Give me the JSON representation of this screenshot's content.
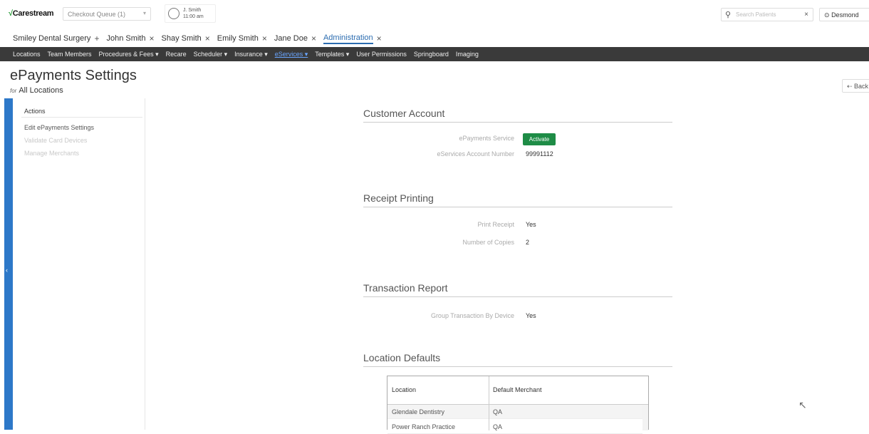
{
  "topbar": {
    "brand": "Carestream",
    "queue_label": "Checkout Queue (1)",
    "user_name": "J. Smith",
    "user_time": "11:00 am",
    "search_placeholder": "Search Patients",
    "account_name": "Desmond"
  },
  "tabs": [
    {
      "label": "Smiley Dental Surgery",
      "symbol": "+"
    },
    {
      "label": "John Smith",
      "symbol": "×"
    },
    {
      "label": "Shay Smith",
      "symbol": "×"
    },
    {
      "label": "Emily Smith",
      "symbol": "×"
    },
    {
      "label": "Jane Doe",
      "symbol": "×"
    },
    {
      "label": "Administration",
      "symbol": "×"
    }
  ],
  "nav": [
    "Locations",
    "Team Members",
    "Procedures & Fees ▾",
    "Recare",
    "Scheduler ▾",
    "Insurance ▾",
    "eServices ▾",
    "Templates ▾",
    "User Permissions",
    "Springboard",
    "Imaging"
  ],
  "page": {
    "title": "ePayments Settings",
    "for_label": "for",
    "scope": "All Locations",
    "back_label": "⇠ Back"
  },
  "sidebar": {
    "heading": "Actions",
    "links": [
      "Edit ePayments Settings",
      "Validate Card Devices",
      "Manage Merchants"
    ]
  },
  "customer_account": {
    "title": "Customer Account",
    "service_label": "ePayments Service",
    "activate_label": "Activate",
    "account_number_label": "eServices Account Number",
    "account_number": "99991112"
  },
  "receipt_printing": {
    "title": "Receipt Printing",
    "print_receipt_label": "Print Receipt",
    "print_receipt_value": "Yes",
    "copies_label": "Number of Copies",
    "copies_value": "2"
  },
  "transaction_report": {
    "title": "Transaction Report",
    "group_label": "Group Transaction By Device",
    "group_value": "Yes"
  },
  "location_defaults": {
    "title": "Location Defaults",
    "col_location": "Location",
    "col_merchant": "Default Merchant",
    "rows": [
      {
        "location": "Glendale Dentistry",
        "merchant": "QA"
      },
      {
        "location": "Power Ranch Practice",
        "merchant": "QA"
      }
    ]
  }
}
